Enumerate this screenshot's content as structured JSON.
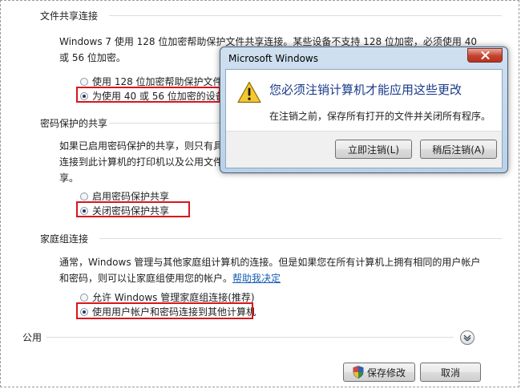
{
  "sections": {
    "file_sharing": {
      "title": "文件共享连接",
      "desc_line1": "Windows 7 使用 128 位加密帮助保护文件共享连接。某些设备不支持 128 位加密，必须使用 40",
      "desc_line2": "或 56 位加密。",
      "options": [
        "使用 128 位加密帮助保护文件",
        "为使用 40 或 56 位加密的设备"
      ],
      "selected_index": 1
    },
    "password_sharing": {
      "title": "密码保护的共享",
      "desc_line1": "如果已启用密码保护的共享，则只有具",
      "desc_line2": "连接到此计算机的打印机以及公用文件",
      "desc_line3": "享。",
      "options": [
        "启用密码保护共享",
        "关闭密码保护共享"
      ],
      "selected_index": 1
    },
    "homegroup": {
      "title": "家庭组连接",
      "desc_line1": "通常，Windows 管理与其他家庭组计算机的连接。但是如果您在所有计算机上拥有相同的用户帐户",
      "desc_line2": "和密码，则可以让家庭组使用您的帐户。",
      "help_link": "帮助我决定",
      "options": [
        "允许 Windows 管理家庭组连接(推荐)",
        "使用用户帐户和密码连接到其他计算机"
      ],
      "selected_index": 1
    },
    "public": {
      "title": "公用"
    }
  },
  "footer": {
    "save_label": "保存修改",
    "cancel_label": "取消"
  },
  "dialog": {
    "title": "Microsoft Windows",
    "message": "您必须注销计算机才能应用这些更改",
    "detail": "在注销之前，保存所有打开的文件并关闭所有程序。",
    "logoff_now_label": "立即注销(L)",
    "logoff_later_label": "稍后注销(A)"
  },
  "colors": {
    "highlight_box": "#d9161c",
    "link": "#1a5fb4",
    "dialog_message": "#1a3a8a"
  }
}
